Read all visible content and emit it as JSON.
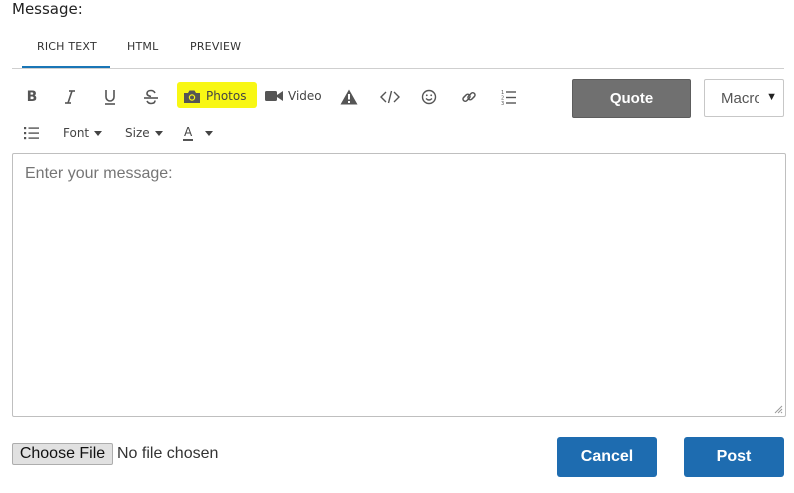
{
  "form": {
    "message_label": "Message:"
  },
  "tabs": [
    {
      "label": "RICH TEXT",
      "active": true
    },
    {
      "label": "HTML",
      "active": false
    },
    {
      "label": "PREVIEW",
      "active": false
    }
  ],
  "toolbar": {
    "bold": "B",
    "photos_label": "Photos",
    "video_label": "Video",
    "font_label": "Font",
    "size_label": "Size",
    "color_label": "A",
    "quote_label": "Quote",
    "macro_value": "Macros",
    "icons": [
      "bold-icon",
      "italic-icon",
      "underline-icon",
      "strikethrough-icon",
      "camera-icon",
      "video-camera-icon",
      "warning-icon",
      "code-icon",
      "emoji-icon",
      "link-icon",
      "ordered-list-icon",
      "unordered-list-icon",
      "font-color-icon"
    ],
    "highlight_color": "#f8f714"
  },
  "editor": {
    "placeholder": "Enter your message:"
  },
  "attachment": {
    "choose_label": "Choose File",
    "status": "No file chosen"
  },
  "actions": {
    "cancel_label": "Cancel",
    "post_label": "Post",
    "primary_color": "#1e6cb0"
  }
}
